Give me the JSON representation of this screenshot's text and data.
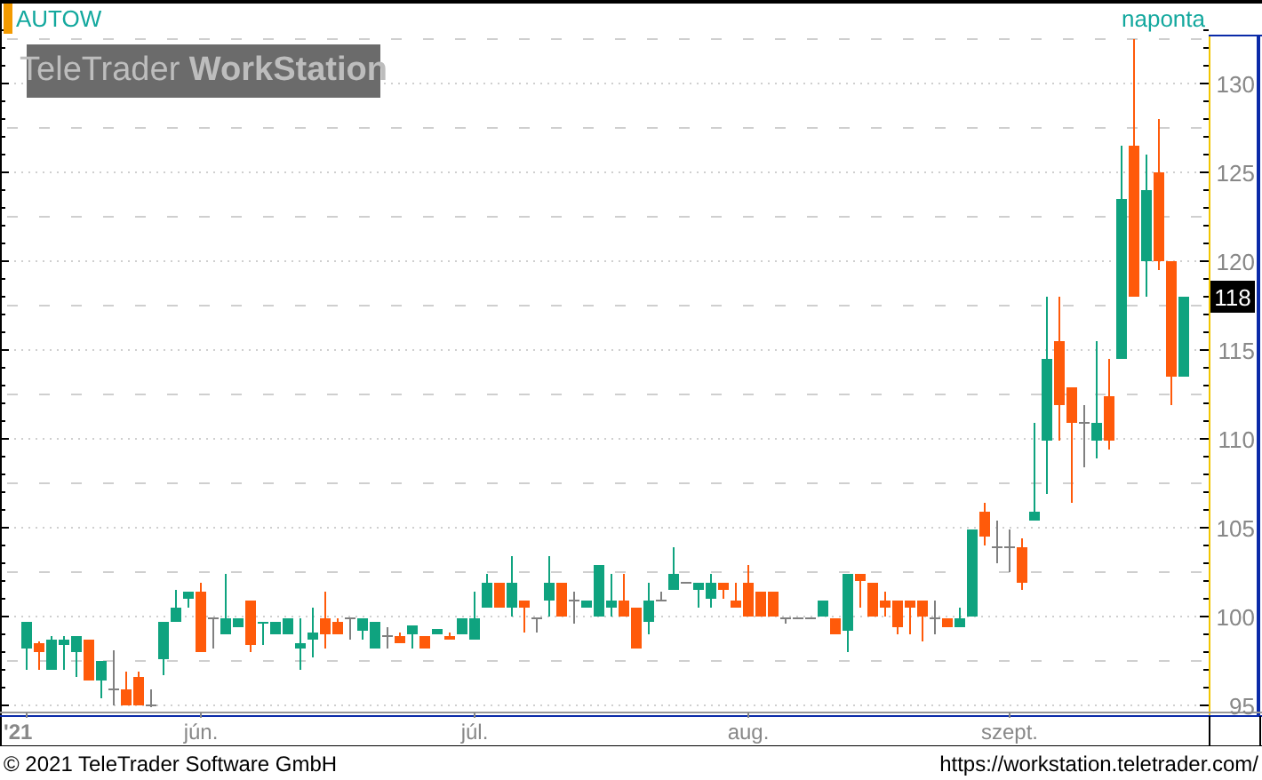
{
  "header": {
    "instrument": "AUTOW",
    "interval": "naponta",
    "logo": "TeleTrader **WorkStation**"
  },
  "chart": {
    "chart_data": {
      "type": "candlestick",
      "categories": [
        "'21",
        null,
        null,
        null,
        null,
        null,
        null,
        null,
        null,
        null,
        null,
        null,
        null,
        null,
        "jún.",
        null,
        null,
        null,
        null,
        null,
        null,
        null,
        null,
        null,
        null,
        null,
        null,
        null,
        null,
        null,
        null,
        null,
        null,
        null,
        null,
        null,
        "júl.",
        null,
        null,
        null,
        null,
        null,
        null,
        null,
        null,
        null,
        null,
        null,
        null,
        null,
        null,
        null,
        null,
        null,
        null,
        null,
        null,
        null,
        "aug.",
        null,
        null,
        null,
        null,
        null,
        null,
        null,
        null,
        null,
        null,
        null,
        null,
        null,
        null,
        null,
        null,
        null,
        null,
        null,
        null,
        "szept.",
        null,
        null,
        null,
        null,
        null,
        null,
        null,
        null,
        null,
        null,
        null,
        null,
        null,
        null
      ],
      "ohlc": [
        [
          98.2,
          99.7,
          97.0,
          99.7
        ],
        [
          98.5,
          98.6,
          97.0,
          98.0
        ],
        [
          97.0,
          98.9,
          97.0,
          98.7
        ],
        [
          98.4,
          98.9,
          97.0,
          98.7
        ],
        [
          98.0,
          98.9,
          96.6,
          98.9
        ],
        [
          98.7,
          98.7,
          96.4,
          96.4
        ],
        [
          96.4,
          97.5,
          95.4,
          97.5
        ],
        [
          95.9,
          98.1,
          95.0,
          95.9
        ],
        [
          95.9,
          96.9,
          95.0,
          95.0
        ],
        [
          96.6,
          96.9,
          95.0,
          95.0
        ],
        [
          95.0,
          95.9,
          94.9,
          95.0
        ],
        [
          97.6,
          99.7,
          96.7,
          99.7
        ],
        [
          99.7,
          101.5,
          99.7,
          100.5
        ],
        [
          101.0,
          101.4,
          100.5,
          101.4
        ],
        [
          101.4,
          101.9,
          98.0,
          98.0
        ],
        [
          99.9,
          99.9,
          98.2,
          99.9
        ],
        [
          99.0,
          102.4,
          99.0,
          99.9
        ],
        [
          99.4,
          99.9,
          99.4,
          99.9
        ],
        [
          100.9,
          100.9,
          98.0,
          98.4
        ],
        [
          99.6,
          99.7,
          98.4,
          99.7
        ],
        [
          99.0,
          99.7,
          99.0,
          99.7
        ],
        [
          99.0,
          99.9,
          99.0,
          99.9
        ],
        [
          98.2,
          99.9,
          97.0,
          98.5
        ],
        [
          98.7,
          100.5,
          97.7,
          99.1
        ],
        [
          99.9,
          101.4,
          98.2,
          99.0
        ],
        [
          99.7,
          99.9,
          99.0,
          99.0
        ],
        [
          99.9,
          99.9,
          98.7,
          99.9
        ],
        [
          99.2,
          99.9,
          98.7,
          99.9
        ],
        [
          98.2,
          99.7,
          98.2,
          99.7
        ],
        [
          98.9,
          99.4,
          98.2,
          98.9
        ],
        [
          98.9,
          99.1,
          98.5,
          98.5
        ],
        [
          99.0,
          99.5,
          98.2,
          99.5
        ],
        [
          98.9,
          98.9,
          98.2,
          98.2
        ],
        [
          99.0,
          99.3,
          99.0,
          99.3
        ],
        [
          98.9,
          99.1,
          98.7,
          98.7
        ],
        [
          99.0,
          99.9,
          99.0,
          99.9
        ],
        [
          98.7,
          101.4,
          98.7,
          99.9
        ],
        [
          100.5,
          102.4,
          100.5,
          101.9
        ],
        [
          101.9,
          101.9,
          100.5,
          100.5
        ],
        [
          100.5,
          103.4,
          100.0,
          101.9
        ],
        [
          100.9,
          100.9,
          99.1,
          100.5
        ],
        [
          99.9,
          99.9,
          99.1,
          99.9
        ],
        [
          100.9,
          103.4,
          100.0,
          101.9
        ],
        [
          101.9,
          101.9,
          100.0,
          100.0
        ],
        [
          100.9,
          101.4,
          99.6,
          100.9
        ],
        [
          100.5,
          100.9,
          100.5,
          100.9
        ],
        [
          100.0,
          102.9,
          100.0,
          102.9
        ],
        [
          100.5,
          102.4,
          100.0,
          100.9
        ],
        [
          100.9,
          102.4,
          100.0,
          100.0
        ],
        [
          100.5,
          100.5,
          98.2,
          98.2
        ],
        [
          99.7,
          101.9,
          99.0,
          100.9
        ],
        [
          100.9,
          101.4,
          100.9,
          100.9
        ],
        [
          101.5,
          103.9,
          101.5,
          102.4
        ],
        [
          101.9,
          101.9,
          101.9,
          101.9
        ],
        [
          101.5,
          101.9,
          100.5,
          101.9
        ],
        [
          101.0,
          102.4,
          100.5,
          101.9
        ],
        [
          101.9,
          101.9,
          101.0,
          101.5
        ],
        [
          100.9,
          101.9,
          100.5,
          100.5
        ],
        [
          101.9,
          102.9,
          100.0,
          100.0
        ],
        [
          101.4,
          101.4,
          100.0,
          100.0
        ],
        [
          101.4,
          101.4,
          100.0,
          100.0
        ],
        [
          99.9,
          99.9,
          99.6,
          99.9
        ],
        [
          99.9,
          99.9,
          99.9,
          99.9
        ],
        [
          99.9,
          99.9,
          99.9,
          99.9
        ],
        [
          100.0,
          100.9,
          100.0,
          100.9
        ],
        [
          99.9,
          99.9,
          99.0,
          99.0
        ],
        [
          99.2,
          102.4,
          98.0,
          102.4
        ],
        [
          102.4,
          102.4,
          100.5,
          102.0
        ],
        [
          101.9,
          101.9,
          100.0,
          100.0
        ],
        [
          100.9,
          101.4,
          100.0,
          100.5
        ],
        [
          100.9,
          100.9,
          99.0,
          99.4
        ],
        [
          100.9,
          100.9,
          99.0,
          100.5
        ],
        [
          100.9,
          100.9,
          98.6,
          100.0
        ],
        [
          99.9,
          100.9,
          99.0,
          99.9
        ],
        [
          99.9,
          99.9,
          99.4,
          99.4
        ],
        [
          99.4,
          100.5,
          99.4,
          99.9
        ],
        [
          100.0,
          104.9,
          100.0,
          104.9
        ],
        [
          105.9,
          106.4,
          104.0,
          104.5
        ],
        [
          103.9,
          105.4,
          103.0,
          103.9
        ],
        [
          103.9,
          104.9,
          102.5,
          103.9
        ],
        [
          103.9,
          104.4,
          101.5,
          101.9
        ],
        [
          105.4,
          110.9,
          105.4,
          105.9
        ],
        [
          109.9,
          118.0,
          106.9,
          114.5
        ],
        [
          115.5,
          118.0,
          109.9,
          111.9
        ],
        [
          112.9,
          112.9,
          106.4,
          110.9
        ],
        [
          110.9,
          111.9,
          108.4,
          110.9
        ],
        [
          109.9,
          115.5,
          108.9,
          110.9
        ],
        [
          112.4,
          114.5,
          109.4,
          109.9
        ],
        [
          114.5,
          126.5,
          114.5,
          123.5
        ],
        [
          126.5,
          132.5,
          118.0,
          118.0
        ],
        [
          120.0,
          126.0,
          118.0,
          124.0
        ],
        [
          125.0,
          128.0,
          119.5,
          120.0
        ],
        [
          120.0,
          120.0,
          111.9,
          113.5
        ],
        [
          113.5,
          118.0,
          113.5,
          118.0
        ]
      ],
      "ylim": [
        94.6,
        132.7
      ],
      "grid": true,
      "yticks": [
        95,
        100,
        105,
        110,
        115,
        120,
        125,
        130
      ]
    },
    "last_value": "118"
  },
  "footer": {
    "copyright": "© 2021 TeleTrader Software GmbH",
    "url": "https://workstation.teletrader.com/"
  }
}
